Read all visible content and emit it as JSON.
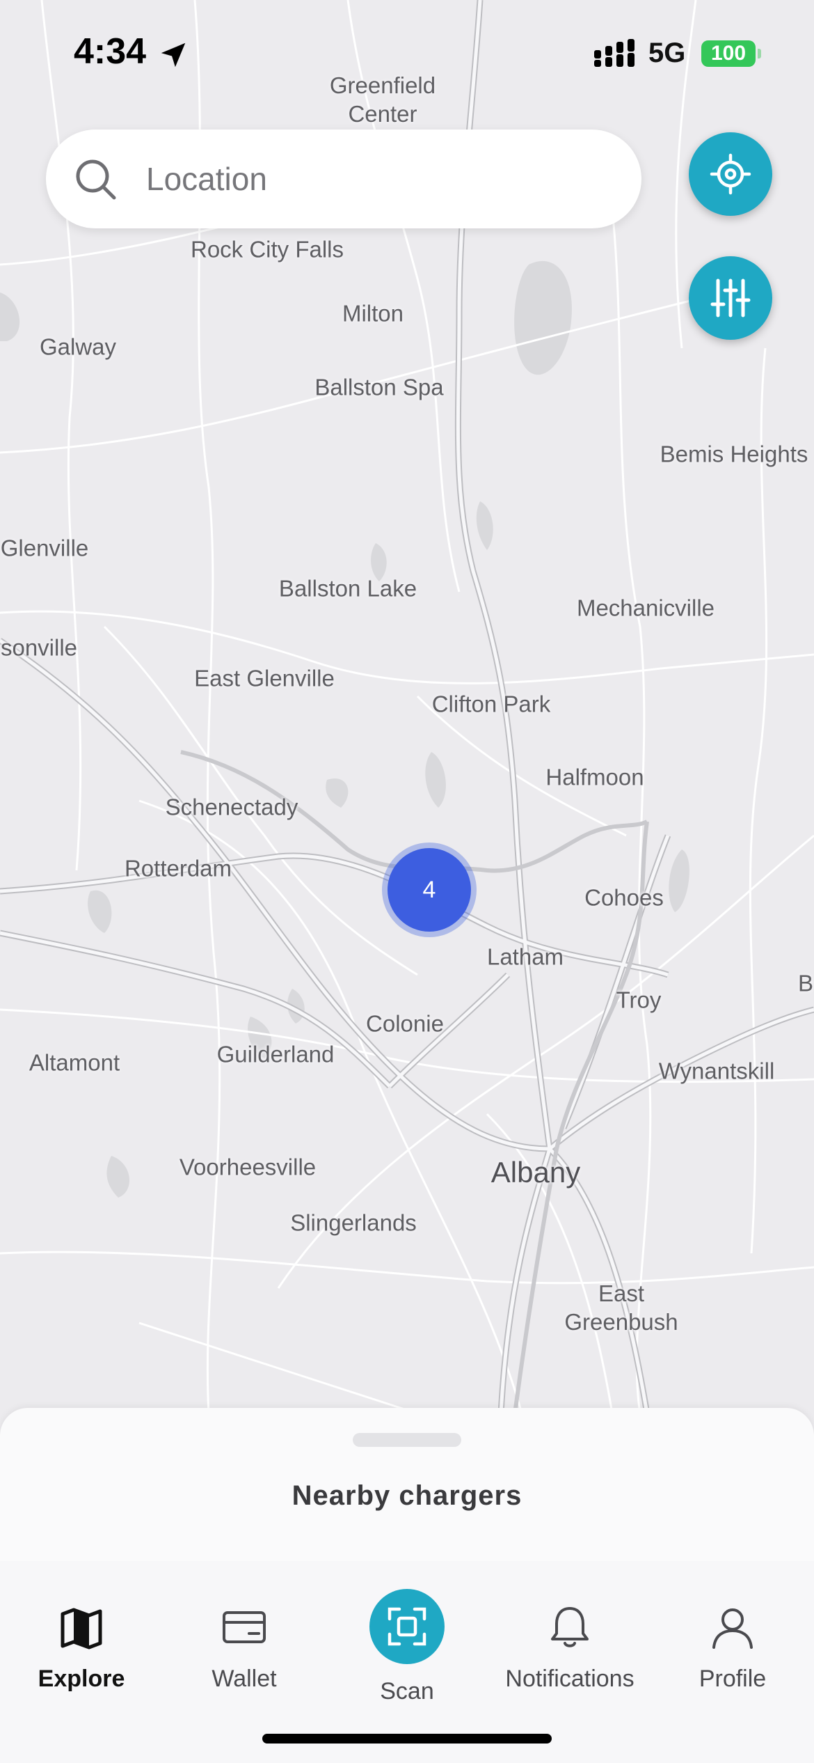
{
  "status_bar": {
    "time": "4:34",
    "network": "5G",
    "battery": "100"
  },
  "search": {
    "placeholder": "Location"
  },
  "map": {
    "cluster_count": "4",
    "places": [
      {
        "name": "Greenfield\nCenter"
      },
      {
        "name": "Rock City Falls"
      },
      {
        "name": "Milton"
      },
      {
        "name": "Galway"
      },
      {
        "name": "Ballston Spa"
      },
      {
        "name": "Bemis Heights"
      },
      {
        "name": "Glenville"
      },
      {
        "name": "Ballston Lake"
      },
      {
        "name": "Mechanicville"
      },
      {
        "name": "sonville"
      },
      {
        "name": "East Glenville"
      },
      {
        "name": "Clifton Park"
      },
      {
        "name": "Halfmoon"
      },
      {
        "name": "Schenectady"
      },
      {
        "name": "Rotterdam"
      },
      {
        "name": "Cohoes"
      },
      {
        "name": "Latham"
      },
      {
        "name": "Troy"
      },
      {
        "name": "B"
      },
      {
        "name": "Colonie"
      },
      {
        "name": "Altamont"
      },
      {
        "name": "Guilderland"
      },
      {
        "name": "Wynantskill"
      },
      {
        "name": "Albany"
      },
      {
        "name": "Voorheesville"
      },
      {
        "name": "Slingerlands"
      },
      {
        "name": "East\nGreenbush"
      }
    ]
  },
  "sheet": {
    "title": "Nearby chargers"
  },
  "tabbar": {
    "tabs": [
      {
        "label": "Explore"
      },
      {
        "label": "Wallet"
      },
      {
        "label": "Scan"
      },
      {
        "label": "Notifications"
      },
      {
        "label": "Profile"
      }
    ]
  },
  "colors": {
    "accent": "#1FA8C4",
    "cluster": "#3D5EE0",
    "map_bg": "#ECEBEE"
  }
}
